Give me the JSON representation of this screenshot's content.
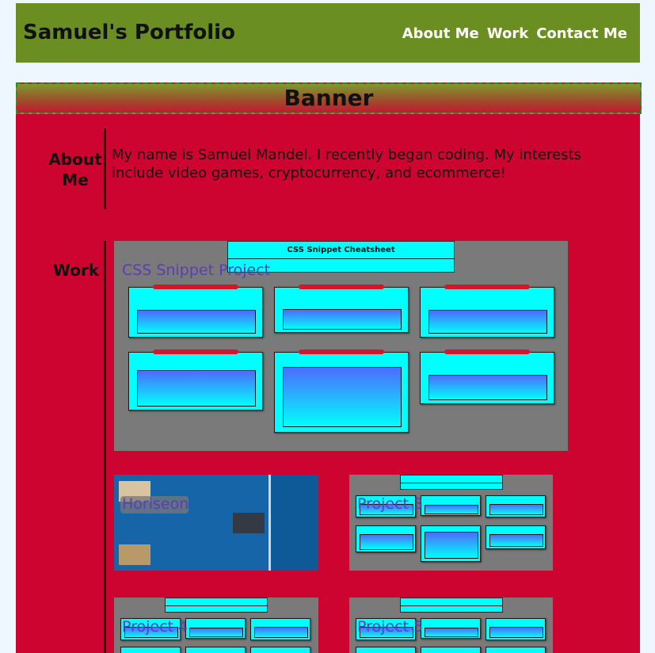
{
  "header": {
    "title": "Samuel's Portfolio",
    "nav": [
      "About Me",
      "Work",
      "Contact Me"
    ]
  },
  "banner": {
    "label": "Banner"
  },
  "about": {
    "heading": "About Me",
    "text": "My name is Samuel Mandel. I recently began coding. My interests include video games, cryptocurrency, and ecommerce!"
  },
  "work": {
    "heading": "Work",
    "projects": [
      {
        "label": "CSS Snippet Project"
      },
      {
        "label": "Horiseon"
      },
      {
        "label": "Project 3"
      },
      {
        "label": "Project 4"
      },
      {
        "label": "Project 5"
      }
    ]
  },
  "cheatsheet": {
    "title": "CSS Snippet Cheatsheet"
  },
  "colors": {
    "header_bg": "#6b8e23",
    "main_bg": "#cd042f",
    "page_bg": "#eef6ff",
    "project_label": "#5a3fb0"
  }
}
